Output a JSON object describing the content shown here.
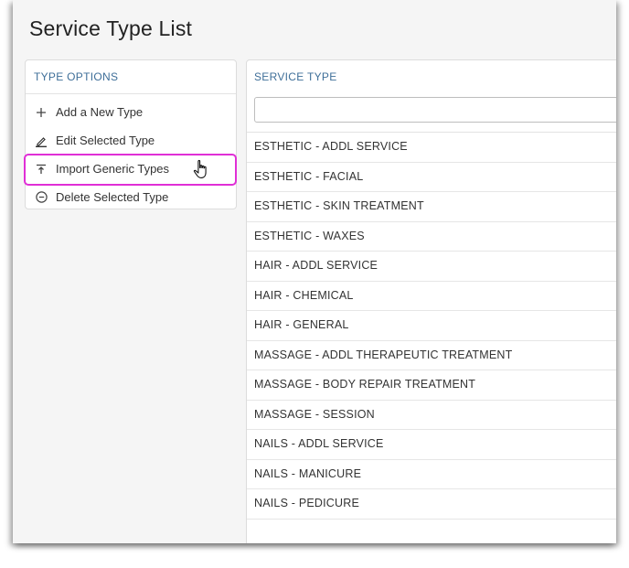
{
  "page": {
    "title": "Service Type List"
  },
  "type_options": {
    "header": "TYPE OPTIONS",
    "items": [
      {
        "label": "Add a New Type",
        "icon": "plus-icon"
      },
      {
        "label": "Edit Selected Type",
        "icon": "pencil-icon"
      },
      {
        "label": "Import Generic Types",
        "icon": "import-icon"
      },
      {
        "label": "Delete Selected Type",
        "icon": "minus-circle-icon"
      }
    ],
    "highlight_color": "#e02fd6"
  },
  "service_type": {
    "header": "SERVICE TYPE",
    "filter": {
      "value": "",
      "placeholder": ""
    },
    "rows": [
      "ESTHETIC - ADDL SERVICE",
      "ESTHETIC - FACIAL",
      "ESTHETIC - SKIN TREATMENT",
      "ESTHETIC - WAXES",
      "HAIR - ADDL SERVICE",
      "HAIR - CHEMICAL",
      "HAIR - GENERAL",
      "MASSAGE - ADDL THERAPEUTIC TREATMENT",
      "MASSAGE - BODY REPAIR TREATMENT",
      "MASSAGE - SESSION",
      "NAILS - ADDL SERVICE",
      "NAILS - MANICURE",
      "NAILS - PEDICURE"
    ]
  },
  "colors": {
    "header_text": "#3f6f99",
    "background": "#f5f5f5"
  }
}
